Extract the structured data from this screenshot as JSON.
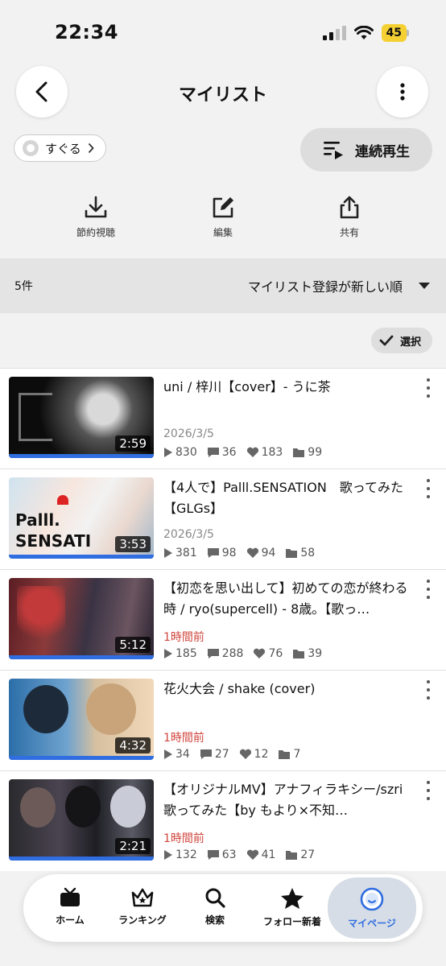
{
  "status": {
    "time": "22:34",
    "battery": "45"
  },
  "header": {
    "title": "マイリスト",
    "back_icon": "chevron-left-icon",
    "more_icon": "more-vertical-icon"
  },
  "owner": {
    "name": "すぐる"
  },
  "continuous_play": {
    "label": "連続再生"
  },
  "actions": [
    {
      "label": "節約視聴",
      "icon": "download-icon"
    },
    {
      "label": "編集",
      "icon": "edit-icon"
    },
    {
      "label": "共有",
      "icon": "share-icon"
    }
  ],
  "list_meta": {
    "count": "5件",
    "sort": "マイリスト登録が新しい順",
    "select_label": "選択"
  },
  "colors": {
    "accent": "#2f6de0",
    "recent": "#d0443c"
  },
  "items": [
    {
      "title": "uni / 梓川【cover】- うに茶",
      "date": "2026/3/5",
      "recent": false,
      "duration": "2:59",
      "views": "830",
      "comments": "36",
      "likes": "183",
      "mylists": "99"
    },
    {
      "title": "【4人で】Palll.SENSATION　歌ってみた【GLGs】",
      "date": "2026/3/5",
      "recent": false,
      "duration": "3:53",
      "views": "381",
      "comments": "98",
      "likes": "94",
      "mylists": "58"
    },
    {
      "title": "【初恋を思い出して】初めての恋が終わる時 / ryo(supercell) - 8歳。【歌っ…",
      "date": "1時間前",
      "recent": true,
      "duration": "5:12",
      "views": "185",
      "comments": "288",
      "likes": "76",
      "mylists": "39"
    },
    {
      "title": "花火大会 / shake (cover)",
      "date": "1時間前",
      "recent": true,
      "duration": "4:32",
      "views": "34",
      "comments": "27",
      "likes": "12",
      "mylists": "7"
    },
    {
      "title": "【オリジナルMV】アナフィラキシー/szri 歌ってみた【by もより×不知…",
      "date": "1時間前",
      "recent": true,
      "duration": "2:21",
      "views": "132",
      "comments": "63",
      "likes": "41",
      "mylists": "27"
    }
  ],
  "tabs": [
    {
      "label": "ホーム",
      "icon": "tv-icon"
    },
    {
      "label": "ランキング",
      "icon": "crown-icon"
    },
    {
      "label": "検索",
      "icon": "search-icon"
    },
    {
      "label": "フォロー新着",
      "icon": "star-icon"
    },
    {
      "label": "マイページ",
      "icon": "smile-icon",
      "active": true
    }
  ]
}
